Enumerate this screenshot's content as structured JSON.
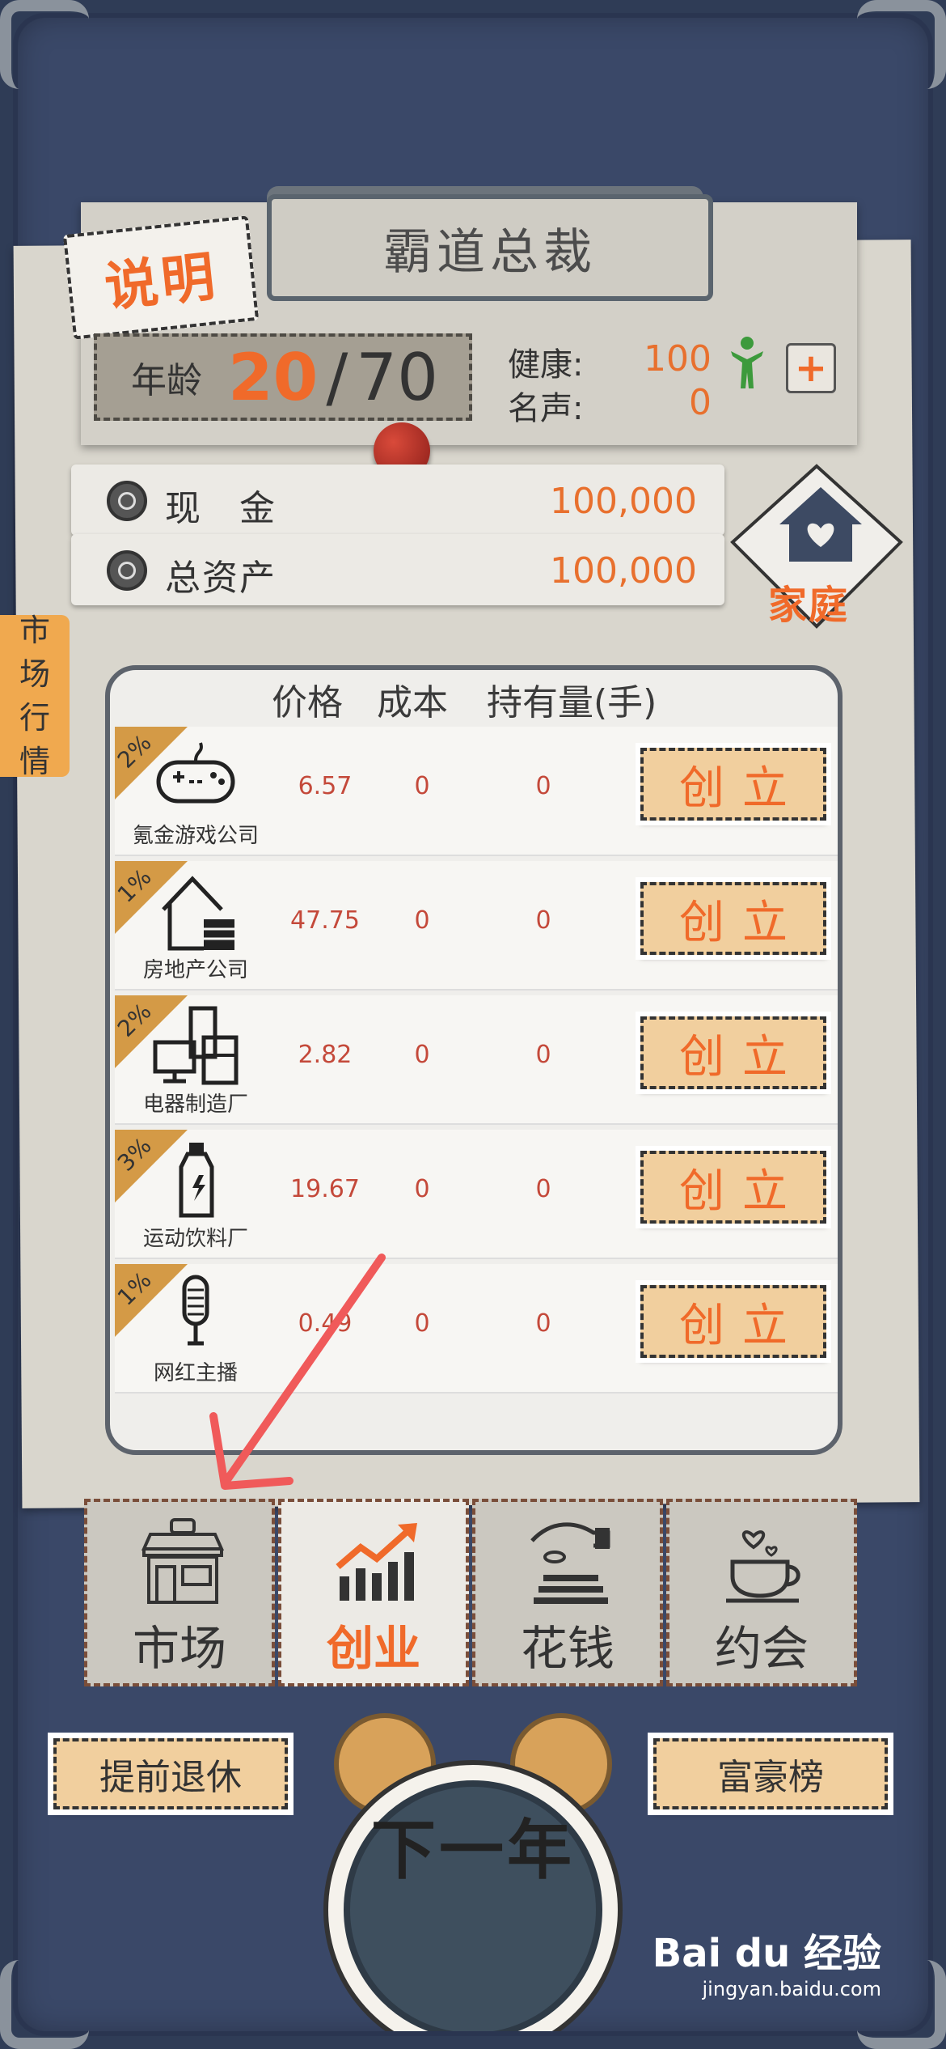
{
  "game_title": "霸道总裁",
  "help_label": "说明",
  "age": {
    "label": "年龄",
    "current": "20",
    "separator": "/",
    "max": "70"
  },
  "health": {
    "label": "健康:",
    "value": "100"
  },
  "fame": {
    "label": "名声:",
    "value": "0"
  },
  "cash": {
    "label": "现　金",
    "value": "100,000"
  },
  "total_assets": {
    "label": "总资产",
    "value": "100,000"
  },
  "home_button": "家庭",
  "market_tab_vertical": [
    "市",
    "场",
    "行",
    "情"
  ],
  "table": {
    "headers": [
      "价格",
      "成本",
      "持有量(手)"
    ],
    "rows": [
      {
        "pct": "2%",
        "name": "氪金游戏公司",
        "icon": "gamepad-icon",
        "price": "6.57",
        "cost": "0",
        "hold": "0",
        "action": "创立"
      },
      {
        "pct": "1%",
        "name": "房地产公司",
        "icon": "house-building-icon",
        "price": "47.75",
        "cost": "0",
        "hold": "0",
        "action": "创立"
      },
      {
        "pct": "2%",
        "name": "电器制造厂",
        "icon": "appliance-icon",
        "price": "2.82",
        "cost": "0",
        "hold": "0",
        "action": "创立"
      },
      {
        "pct": "3%",
        "name": "运动饮料厂",
        "icon": "bottle-icon",
        "price": "19.67",
        "cost": "0",
        "hold": "0",
        "action": "创立"
      },
      {
        "pct": "1%",
        "name": "网红主播",
        "icon": "microphone-icon",
        "price": "0.49",
        "cost": "0",
        "hold": "0",
        "action": "创立"
      }
    ]
  },
  "tabs": [
    {
      "label": "市场",
      "icon": "shop-icon"
    },
    {
      "label": "创业",
      "icon": "growth-chart-icon"
    },
    {
      "label": "花钱",
      "icon": "spend-money-icon"
    },
    {
      "label": "约会",
      "icon": "coffee-cup-icon"
    }
  ],
  "active_tab": "创业",
  "retire_button": "提前退休",
  "rich_list_button": "富豪榜",
  "next_year_button": "下一年",
  "watermark": {
    "logo": "Bai du 经验",
    "url": "jingyan.baidu.com"
  },
  "colors": {
    "accent": "#f06a2a",
    "background": "#2f3c56",
    "button": "#f1cf9e"
  }
}
